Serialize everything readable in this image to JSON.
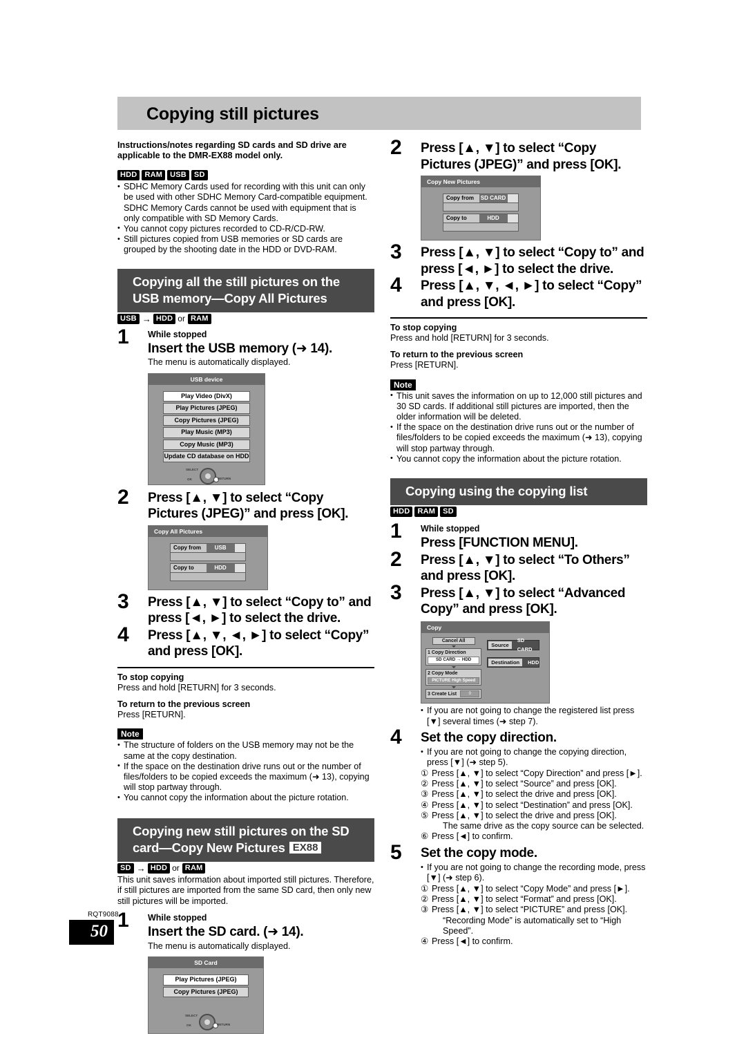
{
  "page": {
    "title": "Copying still pictures",
    "footer_code": "RQT9088",
    "page_number": "50"
  },
  "intro": {
    "note": "Instructions/notes regarding SD cards and SD drive are applicable to the DMR-EX88 model only.",
    "badges": [
      "HDD",
      "RAM",
      "USB",
      "SD"
    ],
    "bullets": [
      "SDHC Memory Cards used for recording with this unit can only be used with other SDHC Memory Card-compatible equipment. SDHC Memory Cards cannot be used with equipment that is only compatible with SD Memory Cards.",
      "You cannot copy pictures recorded to CD-R/CD-RW.",
      "Still pictures copied from USB memories or SD cards are grouped by the shooting date in the HDD or DVD-RAM."
    ]
  },
  "section_usb": {
    "heading": "Copying all the still pictures on the USB memory—Copy All Pictures",
    "flow": {
      "from": "USB",
      "arrow": "→",
      "to1": "HDD",
      "or": "or",
      "to2": "RAM"
    },
    "step1": {
      "num": "1",
      "sub": "While stopped",
      "main": "Insert the USB memory (➜ 14).",
      "note": "The menu is automatically displayed."
    },
    "usb_screen": {
      "title": "USB device",
      "items": [
        {
          "label": "Play Video (DivX)",
          "selected": true
        },
        {
          "label": "Play Pictures (JPEG)",
          "selected": false
        },
        {
          "label": "Copy Pictures (JPEG)",
          "selected": false
        },
        {
          "label": "Play Music (MP3)",
          "selected": false
        },
        {
          "label": "Copy Music (MP3)",
          "selected": false
        },
        {
          "label": "Update CD database on HDD",
          "selected": false
        }
      ],
      "cursor_labels": {
        "select": "SELECT",
        "ok": "OK",
        "return": "RETURN"
      }
    },
    "step2": {
      "num": "2",
      "main": "Press [▲, ▼] to select “Copy Pictures (JPEG)” and press [OK]."
    },
    "copyall_screen": {
      "title": "Copy All Pictures",
      "from_label": "Copy from",
      "from_value": "USB",
      "to_label": "Copy to",
      "to_value": "HDD"
    },
    "step3": {
      "num": "3",
      "main": "Press [▲, ▼] to select “Copy to” and press [◄, ►] to select the drive."
    },
    "step4": {
      "num": "4",
      "main": "Press [▲, ▼, ◄, ►] to select “Copy” and press [OK]."
    },
    "stop_title": "To stop copying",
    "stop_text": "Press and hold [RETURN] for 3 seconds.",
    "return_title": "To return to the previous screen",
    "return_text": "Press [RETURN].",
    "note_tag": "Note",
    "note_bullets": [
      "The structure of folders on the USB memory may not be the same at the copy destination.",
      "If the space on the destination drive runs out or the number of files/folders to be copied exceeds the maximum (➜ 13), copying will stop partway through.",
      "You cannot copy the information about the picture rotation."
    ]
  },
  "section_sd": {
    "heading": "Copying new still pictures on the SD card—Copy New Pictures",
    "heading_badge": "EX88",
    "flow": {
      "from": "SD",
      "arrow": "→",
      "to1": "HDD",
      "or": "or",
      "to2": "RAM"
    },
    "desc": "This unit saves information about imported still pictures. Therefore, if still pictures are imported from the same SD card, then only new still pictures will be imported.",
    "step1": {
      "num": "1",
      "sub": "While stopped",
      "main": "Insert the SD card. (➜ 14).",
      "note": "The menu is automatically displayed."
    },
    "sd_screen": {
      "title": "SD Card",
      "items": [
        {
          "label": "Play Pictures (JPEG)",
          "selected": true
        },
        {
          "label": "Copy Pictures (JPEG)",
          "selected": false
        }
      ],
      "cursor_labels": {
        "select": "SELECT",
        "ok": "OK",
        "return": "RETURN"
      }
    },
    "step2": {
      "num": "2",
      "main": "Press [▲, ▼] to select “Copy Pictures (JPEG)” and press [OK]."
    },
    "copynew_screen": {
      "title": "Copy New Pictures",
      "from_label": "Copy from",
      "from_value": "SD CARD",
      "to_label": "Copy to",
      "to_value": "HDD"
    },
    "step3": {
      "num": "3",
      "main": "Press [▲, ▼] to select “Copy to” and press [◄, ►] to select the drive."
    },
    "step4": {
      "num": "4",
      "main": "Press [▲, ▼, ◄, ►] to select “Copy” and press [OK]."
    },
    "stop_title": "To stop copying",
    "stop_text": "Press and hold [RETURN] for 3 seconds.",
    "return_title": "To return to the previous screen",
    "return_text": "Press [RETURN].",
    "note_tag": "Note",
    "note_bullets": [
      "This unit saves the information on up to 12,000 still pictures and 30 SD cards. If additional still pictures are imported, then the older information will be deleted.",
      "If the space on the destination drive runs out or the number of files/folders to be copied exceeds the maximum (➜ 13), copying will stop partway through.",
      "You cannot copy the information about the picture rotation."
    ]
  },
  "section_list": {
    "heading": "Copying using the copying list",
    "badges": [
      "HDD",
      "RAM",
      "SD"
    ],
    "step1": {
      "num": "1",
      "sub": "While stopped",
      "main": "Press [FUNCTION MENU]."
    },
    "step2": {
      "num": "2",
      "main": "Press [▲, ▼] to select “To Others” and press [OK]."
    },
    "step3": {
      "num": "3",
      "main": "Press [▲, ▼] to select “Advanced Copy” and press [OK]."
    },
    "copy_screen": {
      "title": "Copy",
      "cancel_all": "Cancel All",
      "row1_num": "1",
      "row1_title": "Copy Direction",
      "row1_value": "SD CARD → HDD",
      "row2_num": "2",
      "row2_title": "Copy Mode",
      "row2_value": "PICTURE  High Speed",
      "row3_num": "3",
      "row3_title": "Create List",
      "row3_value": "0",
      "source_label": "Source",
      "source_value": "SD CARD",
      "dest_label": "Destination",
      "dest_value": "HDD"
    },
    "after_screen_bullet": "If you are not going to change the registered list press [▼] several times (➜ step 7).",
    "step4": {
      "num": "4",
      "main": "Set the copy direction.",
      "bullet": "If you are not going to change the copying direction, press [▼] (➜ step 5).",
      "items": [
        {
          "n": "①",
          "t": "Press [▲, ▼] to select “Copy Direction” and press [►]."
        },
        {
          "n": "②",
          "t": "Press [▲, ▼] to select “Source” and press [OK]."
        },
        {
          "n": "③",
          "t": "Press [▲, ▼] to select the drive and press [OK]."
        },
        {
          "n": "④",
          "t": "Press [▲, ▼] to select “Destination” and press [OK]."
        },
        {
          "n": "⑤",
          "t": "Press [▲, ▼] to select the drive and press [OK]."
        }
      ],
      "sub_note": "The same drive as the copy source can be selected.",
      "last": {
        "n": "⑥",
        "t": "Press [◄] to confirm."
      }
    },
    "step5": {
      "num": "5",
      "main": "Set the copy mode.",
      "bullet": "If you are not going to change the recording mode, press [▼] (➜ step 6).",
      "items": [
        {
          "n": "①",
          "t": "Press [▲, ▼] to select “Copy Mode” and press [►]."
        },
        {
          "n": "②",
          "t": "Press [▲, ▼] to select “Format” and press [OK]."
        },
        {
          "n": "③",
          "t": "Press [▲, ▼] to select “PICTURE” and press [OK]."
        }
      ],
      "sub_note": "“Recording Mode” is automatically set to “High Speed”.",
      "last": {
        "n": "④",
        "t": "Press [◄] to confirm."
      }
    }
  }
}
